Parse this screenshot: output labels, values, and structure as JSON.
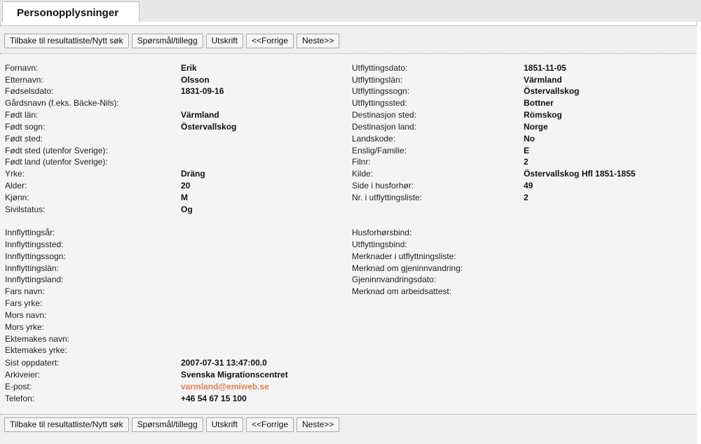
{
  "tab": {
    "title": "Personopplysninger"
  },
  "toolbar": {
    "back": "Tilbake til resultatliste/Nytt søk",
    "question": "Spørsmål/tillegg",
    "print": "Utskrift",
    "prev": "<<Forrige",
    "next": "Neste>>"
  },
  "left_fields": [
    {
      "label": "Fornavn:",
      "value": "Erik"
    },
    {
      "label": "Etternavn:",
      "value": "Olsson"
    },
    {
      "label": "Fødselsdato:",
      "value": "1831-09-16"
    },
    {
      "label": "Gårdsnavn (f.eks. Bäcke-Nils):",
      "value": ""
    },
    {
      "label": "Født län:",
      "value": "Värmland"
    },
    {
      "label": "Født sogn:",
      "value": "Östervallskog"
    },
    {
      "label": "Født sted:",
      "value": ""
    },
    {
      "label": "Født sted (utenfor Sverige):",
      "value": ""
    },
    {
      "label": "Født land (utenfor Sverige):",
      "value": ""
    },
    {
      "label": "Yrke:",
      "value": "Dräng"
    },
    {
      "label": "Alder:",
      "value": "20"
    },
    {
      "label": "Kjønn:",
      "value": "M"
    },
    {
      "label": "Sivilstatus:",
      "value": "Og"
    }
  ],
  "right_fields": [
    {
      "label": "Utflyttingsdato:",
      "value": "1851-11-05"
    },
    {
      "label": "Utflyttingslän:",
      "value": "Värmland"
    },
    {
      "label": "Utflyttingssogn:",
      "value": "Östervallskog"
    },
    {
      "label": "Utflyttingssted:",
      "value": "Bottner"
    },
    {
      "label": "Destinasjon sted:",
      "value": "Römskog"
    },
    {
      "label": "Destinasjon land:",
      "value": "Norge"
    },
    {
      "label": "Landskode:",
      "value": "No"
    },
    {
      "label": "Enslig/Familie:",
      "value": "E"
    },
    {
      "label": "Filnr:",
      "value": "2"
    },
    {
      "label": "Kilde:",
      "value": "Östervallskog Hfl 1851-1855"
    },
    {
      "label": "Side i husforhør:",
      "value": "49"
    },
    {
      "label": "Nr. i utflyttingsliste:",
      "value": "2"
    }
  ],
  "left_fields_2": [
    {
      "label": "Innflyttingsår:",
      "value": ""
    },
    {
      "label": "Innflyttingssted:",
      "value": ""
    },
    {
      "label": "Innflyttingssogn:",
      "value": ""
    },
    {
      "label": "Innflyttingslän:",
      "value": ""
    },
    {
      "label": "Innflyttingsland:",
      "value": ""
    },
    {
      "label": "Fars navn:",
      "value": ""
    },
    {
      "label": "Fars yrke:",
      "value": ""
    },
    {
      "label": "Mors navn:",
      "value": ""
    },
    {
      "label": "Mors yrke:",
      "value": ""
    },
    {
      "label": "Ektemakes navn:",
      "value": ""
    },
    {
      "label": "Ektemakes yrke:",
      "value": ""
    },
    {
      "label": "Sist oppdatert:",
      "value": "2007-07-31 13:47:00.0"
    },
    {
      "label": "Arkiveier:",
      "value": "Svenska Migrationscentret"
    },
    {
      "label": "E-post:",
      "value": "varmland@emiweb.se"
    },
    {
      "label": "Telefon:",
      "value": "+46 54 67 15 100"
    }
  ],
  "right_fields_2": [
    {
      "label": "Husforhørsbind:",
      "value": ""
    },
    {
      "label": "Utflyttingsbind:",
      "value": ""
    },
    {
      "label": "Merknader i utflyttningsliste:",
      "value": ""
    },
    {
      "label": "Merknad om gjeninnvandring:",
      "value": ""
    },
    {
      "label": "Gjeninnvandringsdato:",
      "value": ""
    },
    {
      "label": "Merknad om arbeidsattest:",
      "value": ""
    }
  ]
}
